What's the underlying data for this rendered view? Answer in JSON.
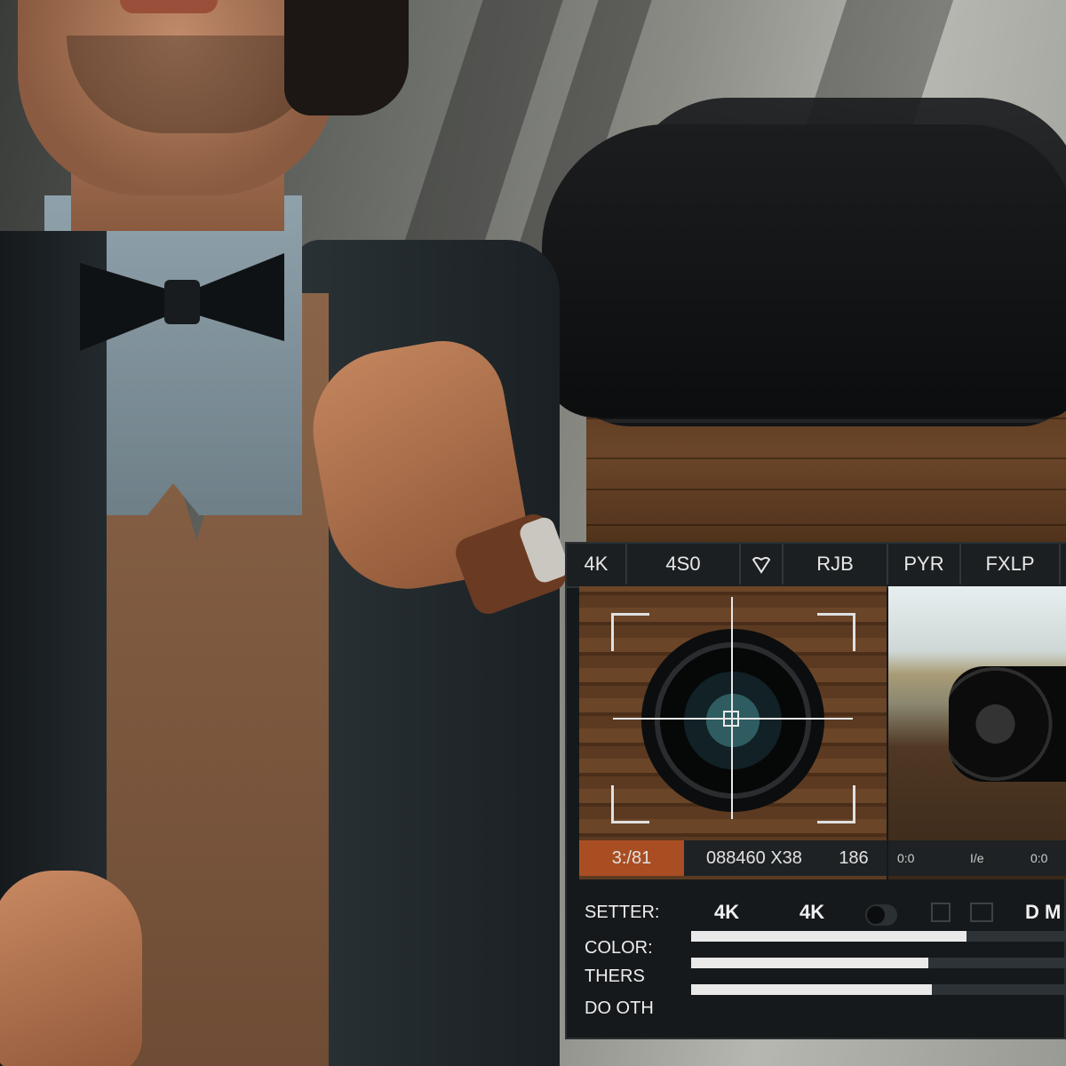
{
  "toolbar": {
    "items": [
      "4K",
      "4S0",
      "",
      "RJB",
      "PYR",
      "FXLP"
    ],
    "heart_icon": "heart-icon"
  },
  "viewfinder": {
    "status": {
      "left": "3:/81",
      "middle": "088460 X38",
      "right": "186"
    },
    "status_right_items": [
      "0:0",
      "I/e",
      "0:0"
    ]
  },
  "settings": {
    "rows": [
      {
        "label": "SETTER:",
        "values": [
          "4K",
          "4K",
          "D M"
        ]
      },
      {
        "label": "COLOR:",
        "level": 0.73
      },
      {
        "label": "THERS",
        "level": 0.63
      },
      {
        "label": "DO OTH",
        "level": 0.64
      }
    ]
  },
  "colors": {
    "panel_bg": "#16191b",
    "accent": "#a94e22",
    "slider_fill": "#e9e9e9"
  }
}
